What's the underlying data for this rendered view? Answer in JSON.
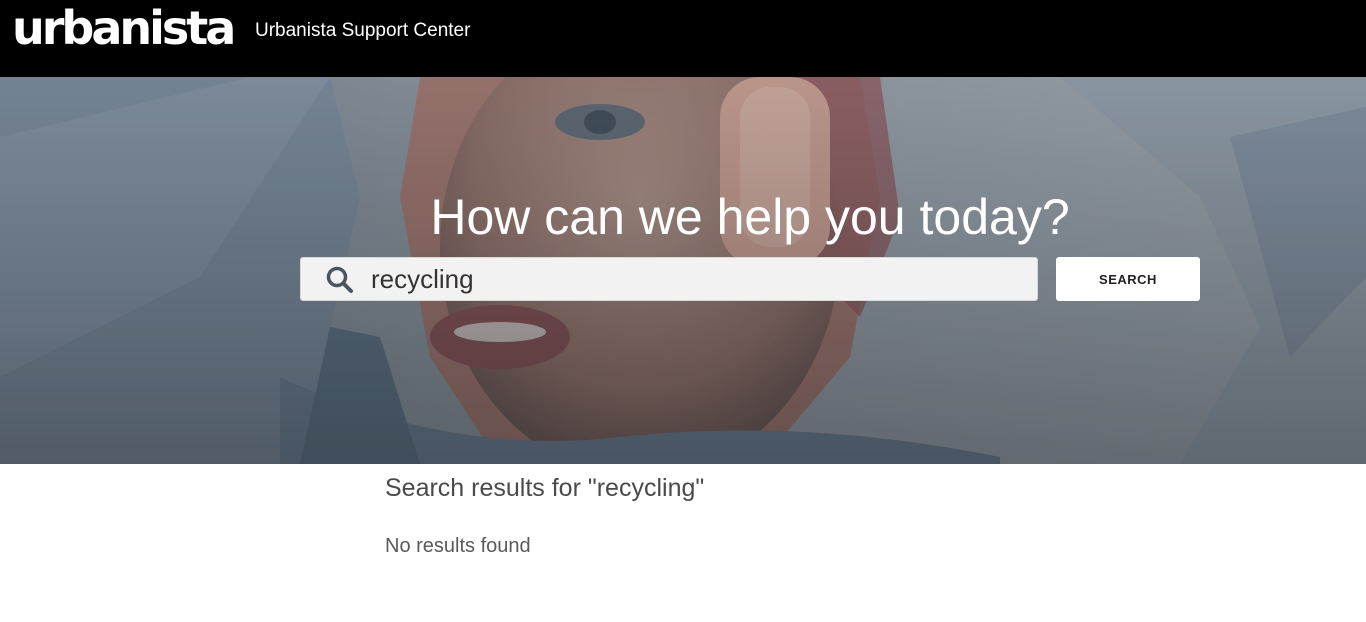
{
  "header": {
    "logo_text": "urbanista",
    "site_title": "Urbanista Support Center"
  },
  "hero": {
    "heading": "How can we help you today?"
  },
  "search": {
    "value": "recycling",
    "button_label": "SEARCH",
    "icon": "search-icon"
  },
  "results": {
    "title": "Search results for \"recycling\"",
    "empty_message": "No results found"
  },
  "colors": {
    "header_bg": "#000000",
    "hero_text": "#ffffff",
    "results_text": "#4a4a4a"
  }
}
